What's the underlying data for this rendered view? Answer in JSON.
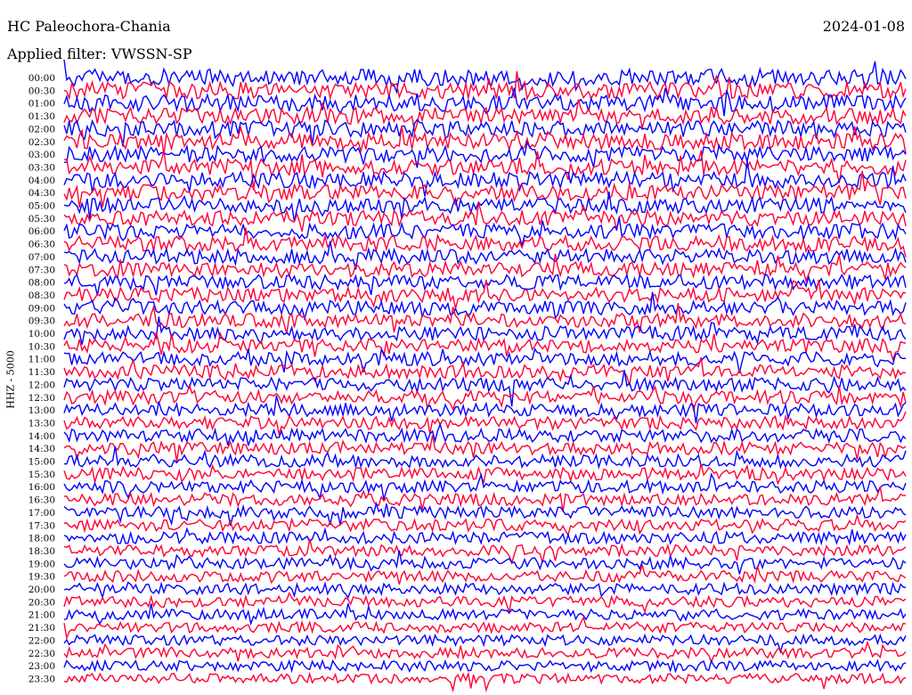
{
  "header": {
    "station": "HC Paleochora-Chania",
    "filter": "Applied filter: VWSSN-SP",
    "date": "2024-01-08"
  },
  "chart_data": {
    "type": "line",
    "title": "HC Paleochora-Chania",
    "subtitle": "Applied filter: VWSSN-SP",
    "date": "2024-01-08",
    "ylabel": "HHZ - 5000",
    "xlabel": "",
    "row_labels": [
      "00:00",
      "00:30",
      "01:00",
      "01:30",
      "02:00",
      "02:30",
      "03:00",
      "03:30",
      "04:00",
      "04:30",
      "05:00",
      "05:30",
      "06:00",
      "06:30",
      "07:00",
      "07:30",
      "08:00",
      "08:30",
      "09:00",
      "09:30",
      "10:00",
      "10:30",
      "11:00",
      "11:30",
      "12:00",
      "12:30",
      "13:00",
      "13:30",
      "14:00",
      "14:30",
      "15:00",
      "15:30",
      "16:00",
      "16:30",
      "17:00",
      "17:30",
      "18:00",
      "18:30",
      "19:00",
      "19:30",
      "20:00",
      "20:30",
      "21:00",
      "21:30",
      "22:00",
      "22:30",
      "23:00",
      "23:30"
    ],
    "series_colors": [
      "#0000ff",
      "#ff0033"
    ],
    "grid": false
  }
}
